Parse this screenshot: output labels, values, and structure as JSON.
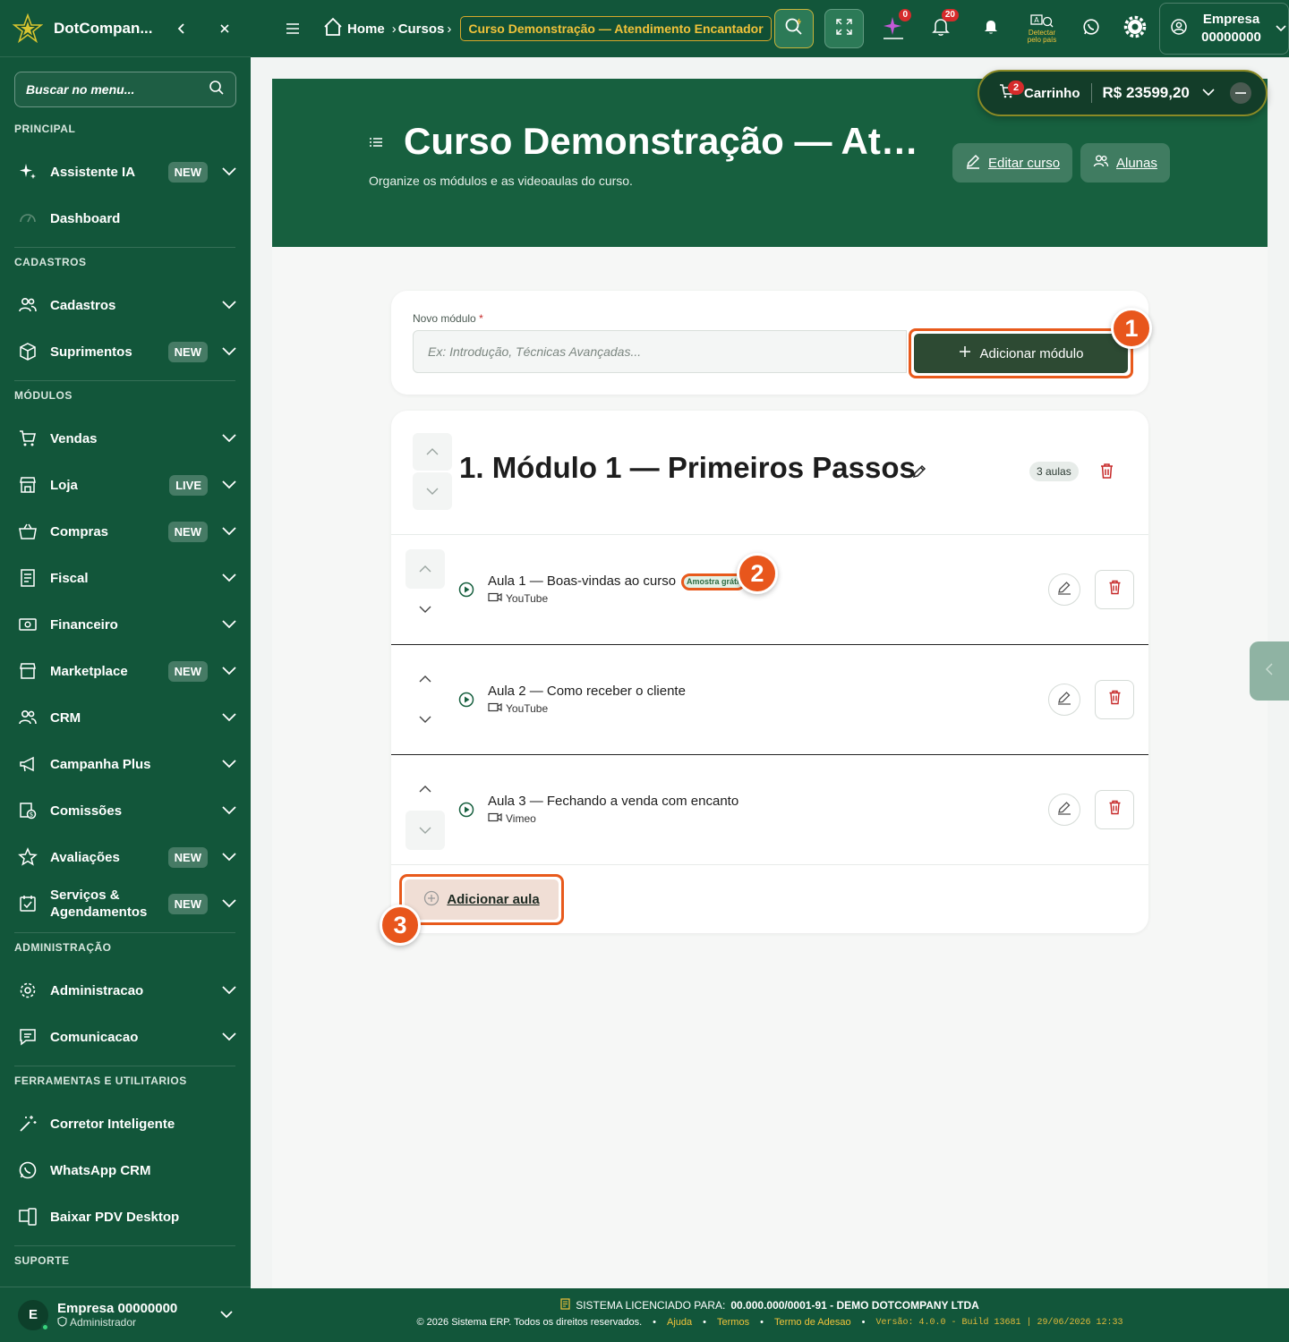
{
  "app": {
    "brand": "DotCompan...",
    "search_placeholder": "Buscar no menu..."
  },
  "sidebar": {
    "sections": {
      "principal": "PRINCIPAL",
      "cadastros": "CADASTROS",
      "modulos": "MÓDULOS",
      "administracao": "ADMINISTRAÇÃO",
      "ferramentas": "FERRAMENTAS E UTILITARIOS",
      "suporte": "SUPORTE"
    },
    "items": {
      "assistente": {
        "label": "Assistente IA",
        "badge": "NEW"
      },
      "dashboard": {
        "label": "Dashboard"
      },
      "cadastros": {
        "label": "Cadastros"
      },
      "suprimentos": {
        "label": "Suprimentos",
        "badge": "NEW"
      },
      "vendas": {
        "label": "Vendas"
      },
      "loja": {
        "label": "Loja",
        "badge": "LIVE"
      },
      "compras": {
        "label": "Compras",
        "badge": "NEW"
      },
      "fiscal": {
        "label": "Fiscal"
      },
      "financeiro": {
        "label": "Financeiro"
      },
      "marketplace": {
        "label": "Marketplace",
        "badge": "NEW"
      },
      "crm": {
        "label": "CRM"
      },
      "campanha": {
        "label": "Campanha Plus"
      },
      "comissoes": {
        "label": "Comissões"
      },
      "avaliacoes": {
        "label": "Avaliações",
        "badge": "NEW"
      },
      "servicos": {
        "label": "Serviços & Agendamentos",
        "badge": "NEW"
      },
      "administracao": {
        "label": "Administracao"
      },
      "comunicacao": {
        "label": "Comunicacao"
      },
      "corretor": {
        "label": "Corretor Inteligente"
      },
      "whatsapp": {
        "label": "WhatsApp CRM"
      },
      "pdv": {
        "label": "Baixar PDV Desktop"
      }
    },
    "user": {
      "initial": "E",
      "name": "Empresa 00000000",
      "role": "Administrador"
    }
  },
  "topbar": {
    "breadcrumb": {
      "home": "Home",
      "cursos": "Cursos",
      "current": "Curso Demonstração — Atendimento Encantador"
    },
    "ai_badge": "0",
    "notif_badge": "20",
    "detect_label_1": "Detectar",
    "detect_label_2": "pelo país",
    "company": {
      "line1": "Empresa",
      "line2": "00000000"
    }
  },
  "cart": {
    "count": "2",
    "label": "Carrinho",
    "total": "R$ 23599,20"
  },
  "hero": {
    "title": "Curso Demonstração — Atendimento Encantador",
    "subtitle": "Organize os módulos e as videoaulas do curso.",
    "edit_course": "Editar curso",
    "students": "Alunas"
  },
  "new_module": {
    "label": "Novo módulo",
    "required_mark": "*",
    "placeholder": "Ex: Introdução, Técnicas Avançadas...",
    "add_button": "Adicionar módulo"
  },
  "module": {
    "title": "1. Módulo 1 — Primeiros Passos",
    "lesson_count": "3 aulas",
    "lessons": [
      {
        "title": "Aula 1 — Boas-vindas ao curso",
        "source": "YouTube",
        "tag": "Amostra grátis"
      },
      {
        "title": "Aula 2 — Como receber o cliente",
        "source": "YouTube"
      },
      {
        "title": "Aula 3 — Fechando a venda com encanto",
        "source": "Vimeo"
      }
    ],
    "add_lesson": "Adicionar aula"
  },
  "callouts": {
    "one": "1",
    "two": "2",
    "three": "3"
  },
  "footer": {
    "licensed_label": "SISTEMA LICENCIADO PARA:",
    "licensed_value": "00.000.000/0001-91 - DEMO DOTCOMPANY LTDA",
    "copyright": "© 2026 Sistema ERP. Todos os direitos reservados.",
    "help": "Ajuda",
    "terms": "Termos",
    "adhesion": "Termo de Adesao",
    "version": "Versão: 4.0.0 - Build 13681 | 29/06/2026 12:33"
  },
  "colors": {
    "primary_green": "#12563a",
    "accent_orange": "#e85a1c",
    "gold": "#f0c23a",
    "danger": "#c62828"
  }
}
